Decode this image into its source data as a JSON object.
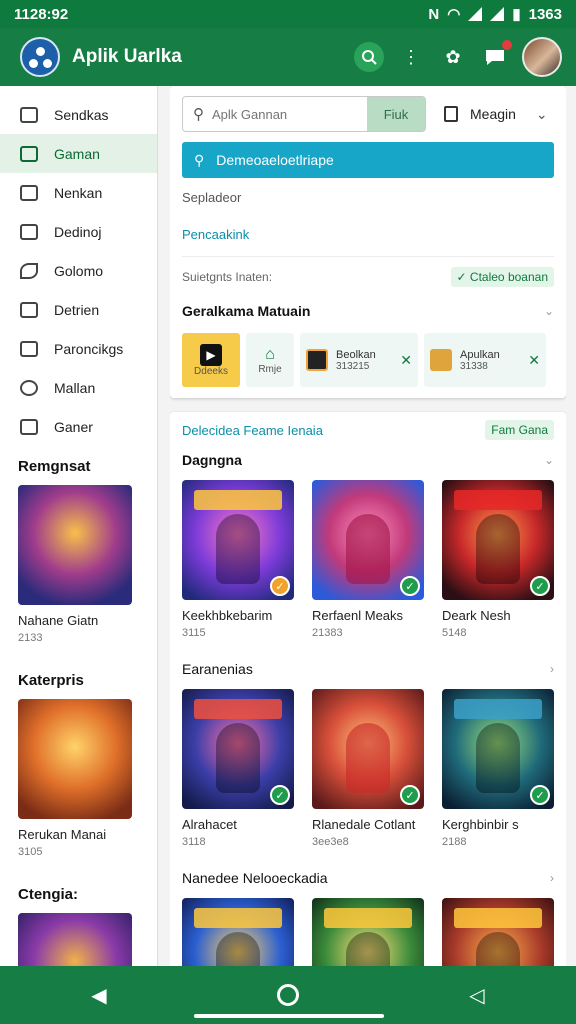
{
  "status_bar": {
    "time": "1128:92",
    "right_text": "1363"
  },
  "app_bar": {
    "title": "Aplik Uarlka"
  },
  "sidebar": {
    "items": [
      {
        "label": "Sendkas",
        "icon": "tablet-icon"
      },
      {
        "label": "Gaman",
        "icon": "calendar-icon",
        "active": true
      },
      {
        "label": "Nenkan",
        "icon": "document-icon"
      },
      {
        "label": "Dedinoj",
        "icon": "phone-icon"
      },
      {
        "label": "Golomo",
        "icon": "leaf-icon"
      },
      {
        "label": "Detrien",
        "icon": "briefcase-icon"
      },
      {
        "label": "Paroncikgs",
        "icon": "camera-icon"
      },
      {
        "label": "Mallan",
        "icon": "target-icon"
      },
      {
        "label": "Ganer",
        "icon": "flag-icon"
      }
    ],
    "sections": [
      {
        "heading": "Remgnsat",
        "title": "Nahane Giatn",
        "sub": "2133"
      },
      {
        "heading": "Katerpris",
        "title": "Rerukan Manai",
        "sub": "3105"
      },
      {
        "heading": "Ctengia:",
        "title": "",
        "sub": ""
      }
    ]
  },
  "top_panel": {
    "search_placeholder": "Aplk Gannan",
    "search_button": "Fiuk",
    "login_label": "Meagin",
    "promo_text": "Demeoaeloetlriape",
    "muted_label": "Sepladeor",
    "link_text": "Pencaakink",
    "info_label": "Suietgnts Inaten:",
    "info_chip": "Ctaleo boanan",
    "section_title": "Geralkama Matuain",
    "tiles": [
      {
        "label": "",
        "value": "Ddeeks"
      },
      {
        "label": "",
        "value": "Rmje"
      },
      {
        "label": "Beolkan",
        "value": "313215"
      },
      {
        "label": "Apulkan",
        "value": "31338"
      }
    ]
  },
  "games_panel": {
    "header_link": "Delecidea Feame Ienaia",
    "header_button": "Fam Gana",
    "rows": [
      {
        "title": "Dagngna",
        "items": [
          {
            "title": "Keekhbkebarim",
            "sub": "3115",
            "check": "orange"
          },
          {
            "title": "Rerfaenl Meaks",
            "sub": "21383",
            "check": "green"
          },
          {
            "title": "Deark Nesh",
            "sub": "5148",
            "check": "green"
          }
        ]
      },
      {
        "title": "Earanenias",
        "items": [
          {
            "title": "Alrahacet",
            "sub": "3118",
            "check": "green"
          },
          {
            "title": "Rlanedale Cotlant",
            "sub": "3ee3e8",
            "check": "green"
          },
          {
            "title": "Kerghbinbir  s",
            "sub": "2188",
            "check": "green"
          }
        ]
      },
      {
        "title": "Nanedee Nelooeckadia",
        "items": [
          {
            "title": "",
            "sub": ""
          },
          {
            "title": "",
            "sub": ""
          },
          {
            "title": "",
            "sub": ""
          }
        ]
      }
    ]
  },
  "colors": {
    "brand_green": "#167d45",
    "accent_teal": "#18a6c8",
    "check_green": "#1f9d4d"
  }
}
